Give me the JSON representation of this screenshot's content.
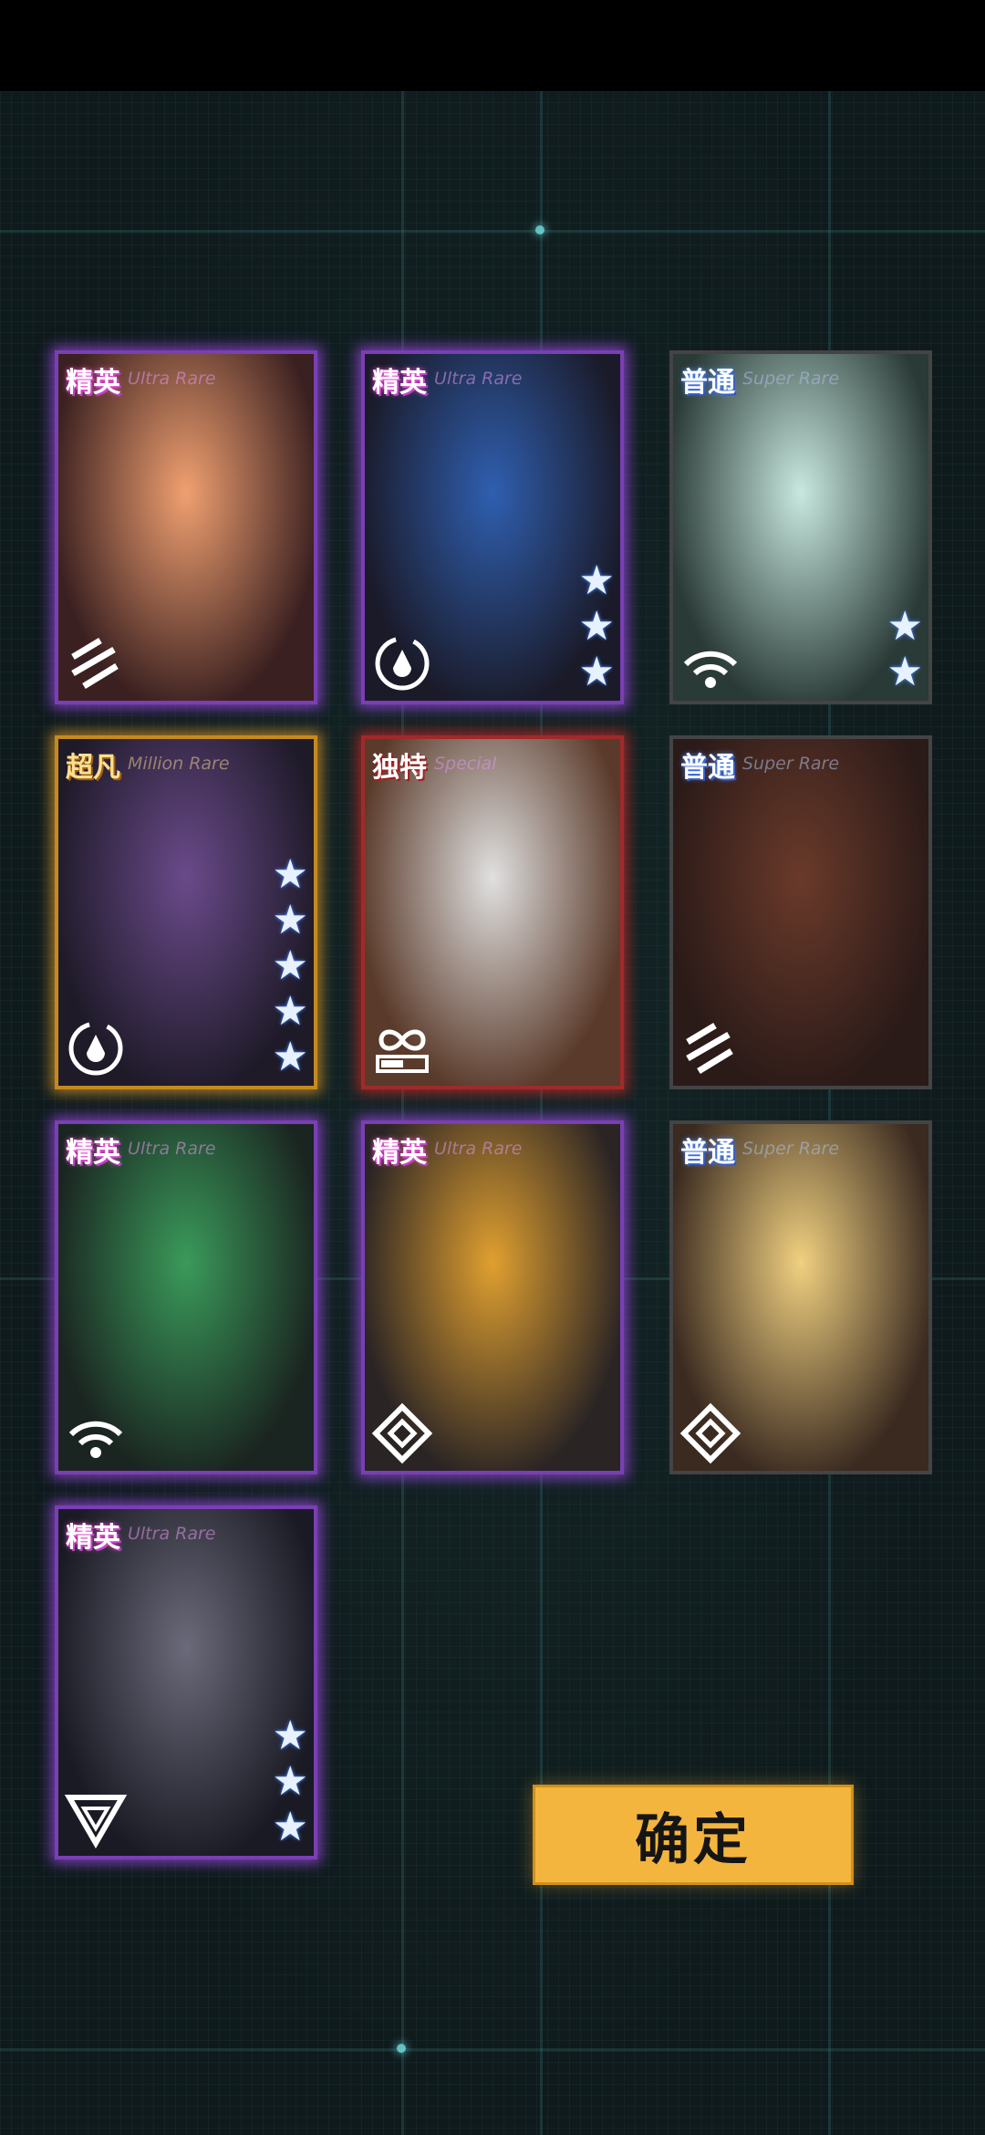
{
  "cards": [
    {
      "rarity_cn": "精英",
      "rarity_en": "Ultra Rare",
      "stars": 0,
      "icon": "class-triple-slash-icon",
      "tier": "elite",
      "art_colors": [
        "#f0a070",
        "#3a2020"
      ]
    },
    {
      "rarity_cn": "精英",
      "rarity_en": "Ultra Rare",
      "stars": 3,
      "icon": "class-drop-circle-icon",
      "tier": "elite",
      "art_colors": [
        "#2f5fb0",
        "#1a1a28"
      ]
    },
    {
      "rarity_cn": "普通",
      "rarity_en": "Super Rare",
      "stars": 2,
      "icon": "class-wifi-icon",
      "tier": "normal",
      "art_colors": [
        "#c8e8e0",
        "#2a3a36"
      ]
    },
    {
      "rarity_cn": "超凡",
      "rarity_en": "Million Rare",
      "stars": 5,
      "icon": "class-drop-circle-icon",
      "tier": "legend",
      "art_colors": [
        "#6a4a8a",
        "#1e1a28"
      ]
    },
    {
      "rarity_cn": "独特",
      "rarity_en": "Special",
      "stars": 0,
      "icon": "class-infinity-battery-icon",
      "tier": "unique",
      "art_colors": [
        "#e0e0e0",
        "#5a3a2a"
      ]
    },
    {
      "rarity_cn": "普通",
      "rarity_en": "Super Rare",
      "stars": 0,
      "icon": "class-triple-slash-icon",
      "tier": "normal",
      "art_colors": [
        "#6a3a2a",
        "#2a1a18"
      ]
    },
    {
      "rarity_cn": "精英",
      "rarity_en": "Ultra Rare",
      "stars": 0,
      "icon": "class-wifi-icon",
      "tier": "elite",
      "art_colors": [
        "#3a9a5a",
        "#1a2420"
      ]
    },
    {
      "rarity_cn": "精英",
      "rarity_en": "Ultra Rare",
      "stars": 0,
      "icon": "class-diamond-icon",
      "tier": "elite",
      "art_colors": [
        "#e0a030",
        "#2a2424"
      ]
    },
    {
      "rarity_cn": "普通",
      "rarity_en": "Super Rare",
      "stars": 0,
      "icon": "class-diamond-icon",
      "tier": "normal",
      "art_colors": [
        "#f0d080",
        "#3a2a20"
      ]
    },
    {
      "rarity_cn": "精英",
      "rarity_en": "Ultra Rare",
      "stars": 3,
      "icon": "class-triangle-icon",
      "tier": "elite",
      "art_colors": [
        "#6a6a7a",
        "#1a1a24"
      ]
    }
  ],
  "confirm_label": "确定",
  "colors": {
    "confirm_bg": "#f3b53d",
    "elite_glow": "#9a4fe0",
    "legend_glow": "#dc9628",
    "unique_glow": "#c82828"
  }
}
